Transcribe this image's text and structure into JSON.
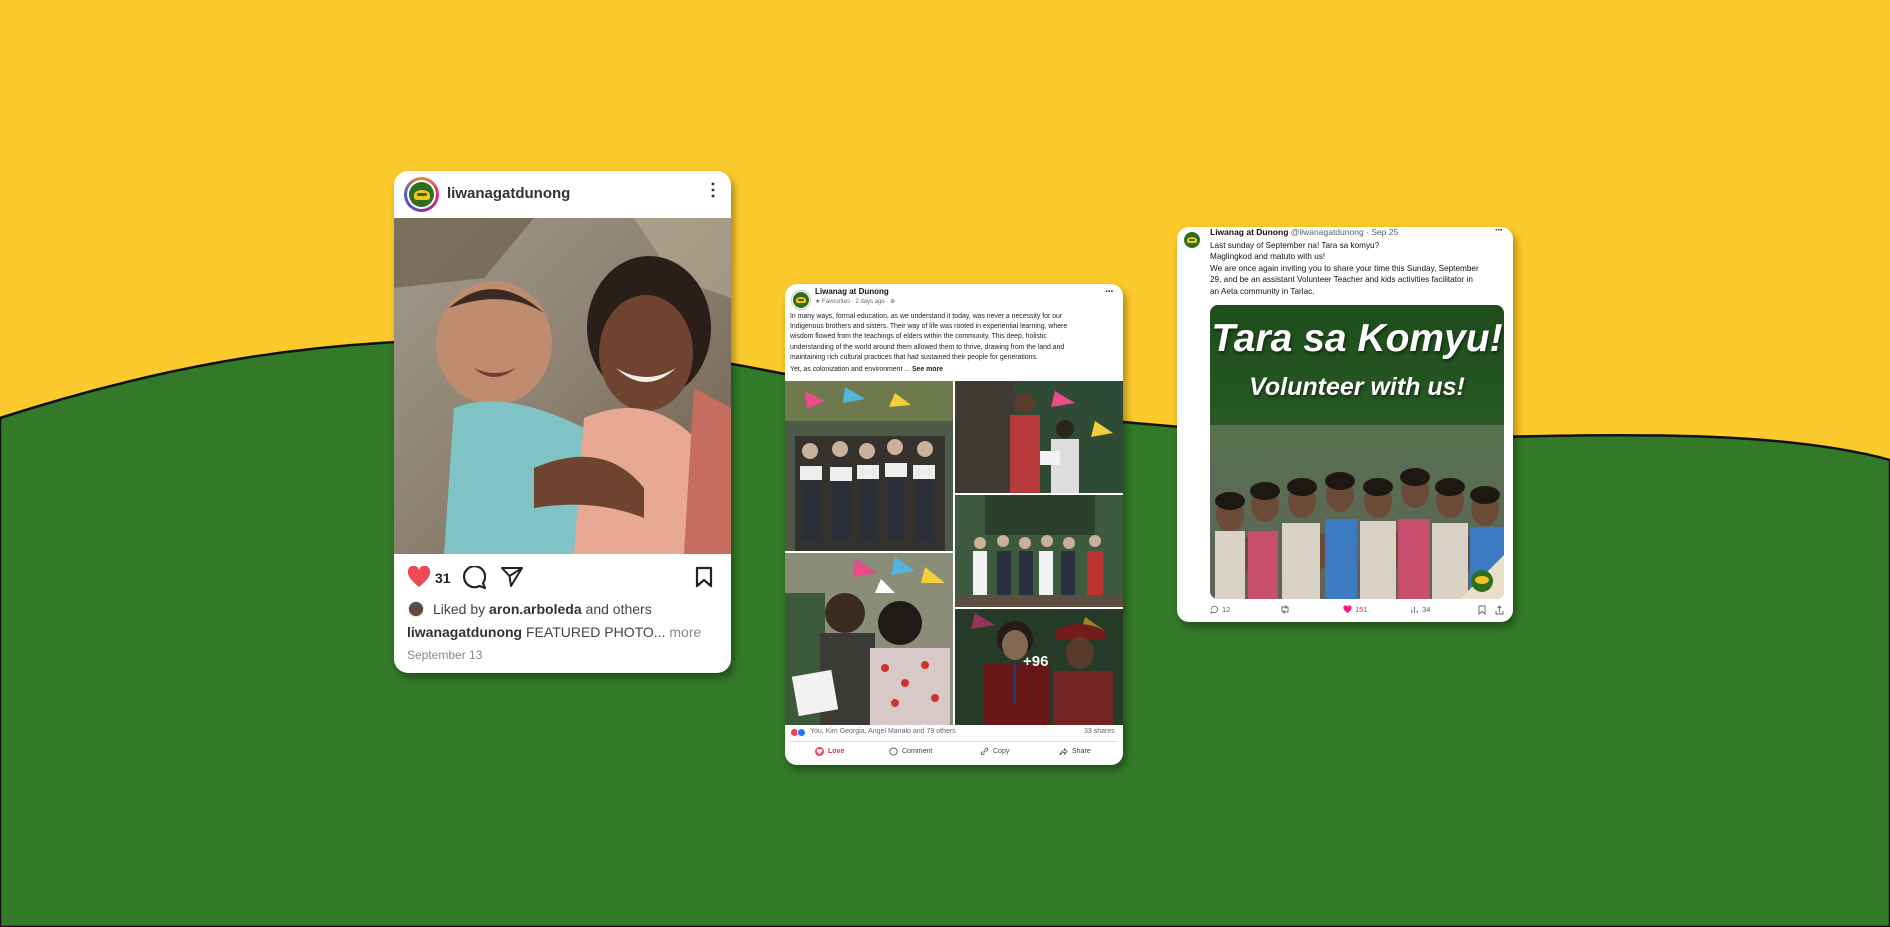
{
  "colors": {
    "yellow": "#fcca2c",
    "green": "#327a27",
    "like_red": "#ed4956",
    "fb_love": "#e0245e",
    "tw_pink": "#f91880"
  },
  "instagram": {
    "username": "liwanagatdunong",
    "likes_count": "31",
    "liked_by_prefix": "Liked by",
    "liked_by_user": "aron.arboleda",
    "liked_by_suffix": "and others",
    "caption_user": "liwanagatdunong",
    "caption_text": "FEATURED PHOTO...",
    "more_label": "more",
    "date": "September 13",
    "icons": [
      "avatar-logo",
      "kebab-menu-icon",
      "heart-icon",
      "comment-icon",
      "share-icon",
      "bookmark-icon"
    ]
  },
  "facebook": {
    "page_name": "Liwanag at Dunong",
    "meta": "★ Favourites · 2 days ago · ⊕",
    "body_lines": [
      "In many ways, formal education, as we understand it today, was never a necessity for our",
      "Indigenous brothers and sisters. Their way of life was rooted in experiential learning, where",
      "wisdom flowed from the teachings of elders within the community. This deep, holistic",
      "understanding of the world around them allowed them to thrive, drawing from the land and",
      "maintaining rich cultural practices that had sustained their people for generations."
    ],
    "body_tail": "Yet, as colonization and environment ...",
    "see_more": "See more",
    "more_photos": "+96",
    "reactions_text": "You, Kim Georgia, Angel Manalo and 79 others",
    "shares_text": "33 shares",
    "actions": {
      "love": "Love",
      "comment": "Comment",
      "copy": "Copy",
      "share": "Share"
    }
  },
  "x_post": {
    "display_name": "Liwanag at Dunong",
    "handle_date": "@liwanagatdunong · Sep 25",
    "lines": [
      "Last sunday of September na! Tara sa komyu?",
      "Maglingkod and matuto with us!",
      "We are once again inviting you to share your time this Sunday, September",
      "29, and be an assistant Volunteer Teacher and kids activities facilitator in",
      "an Aeta community in Tarlac."
    ],
    "banner_title": "Tara sa Komyu!",
    "banner_subtitle": "Volunteer with us!",
    "stats": {
      "replies": "12",
      "likes": "151",
      "views": "34"
    }
  }
}
